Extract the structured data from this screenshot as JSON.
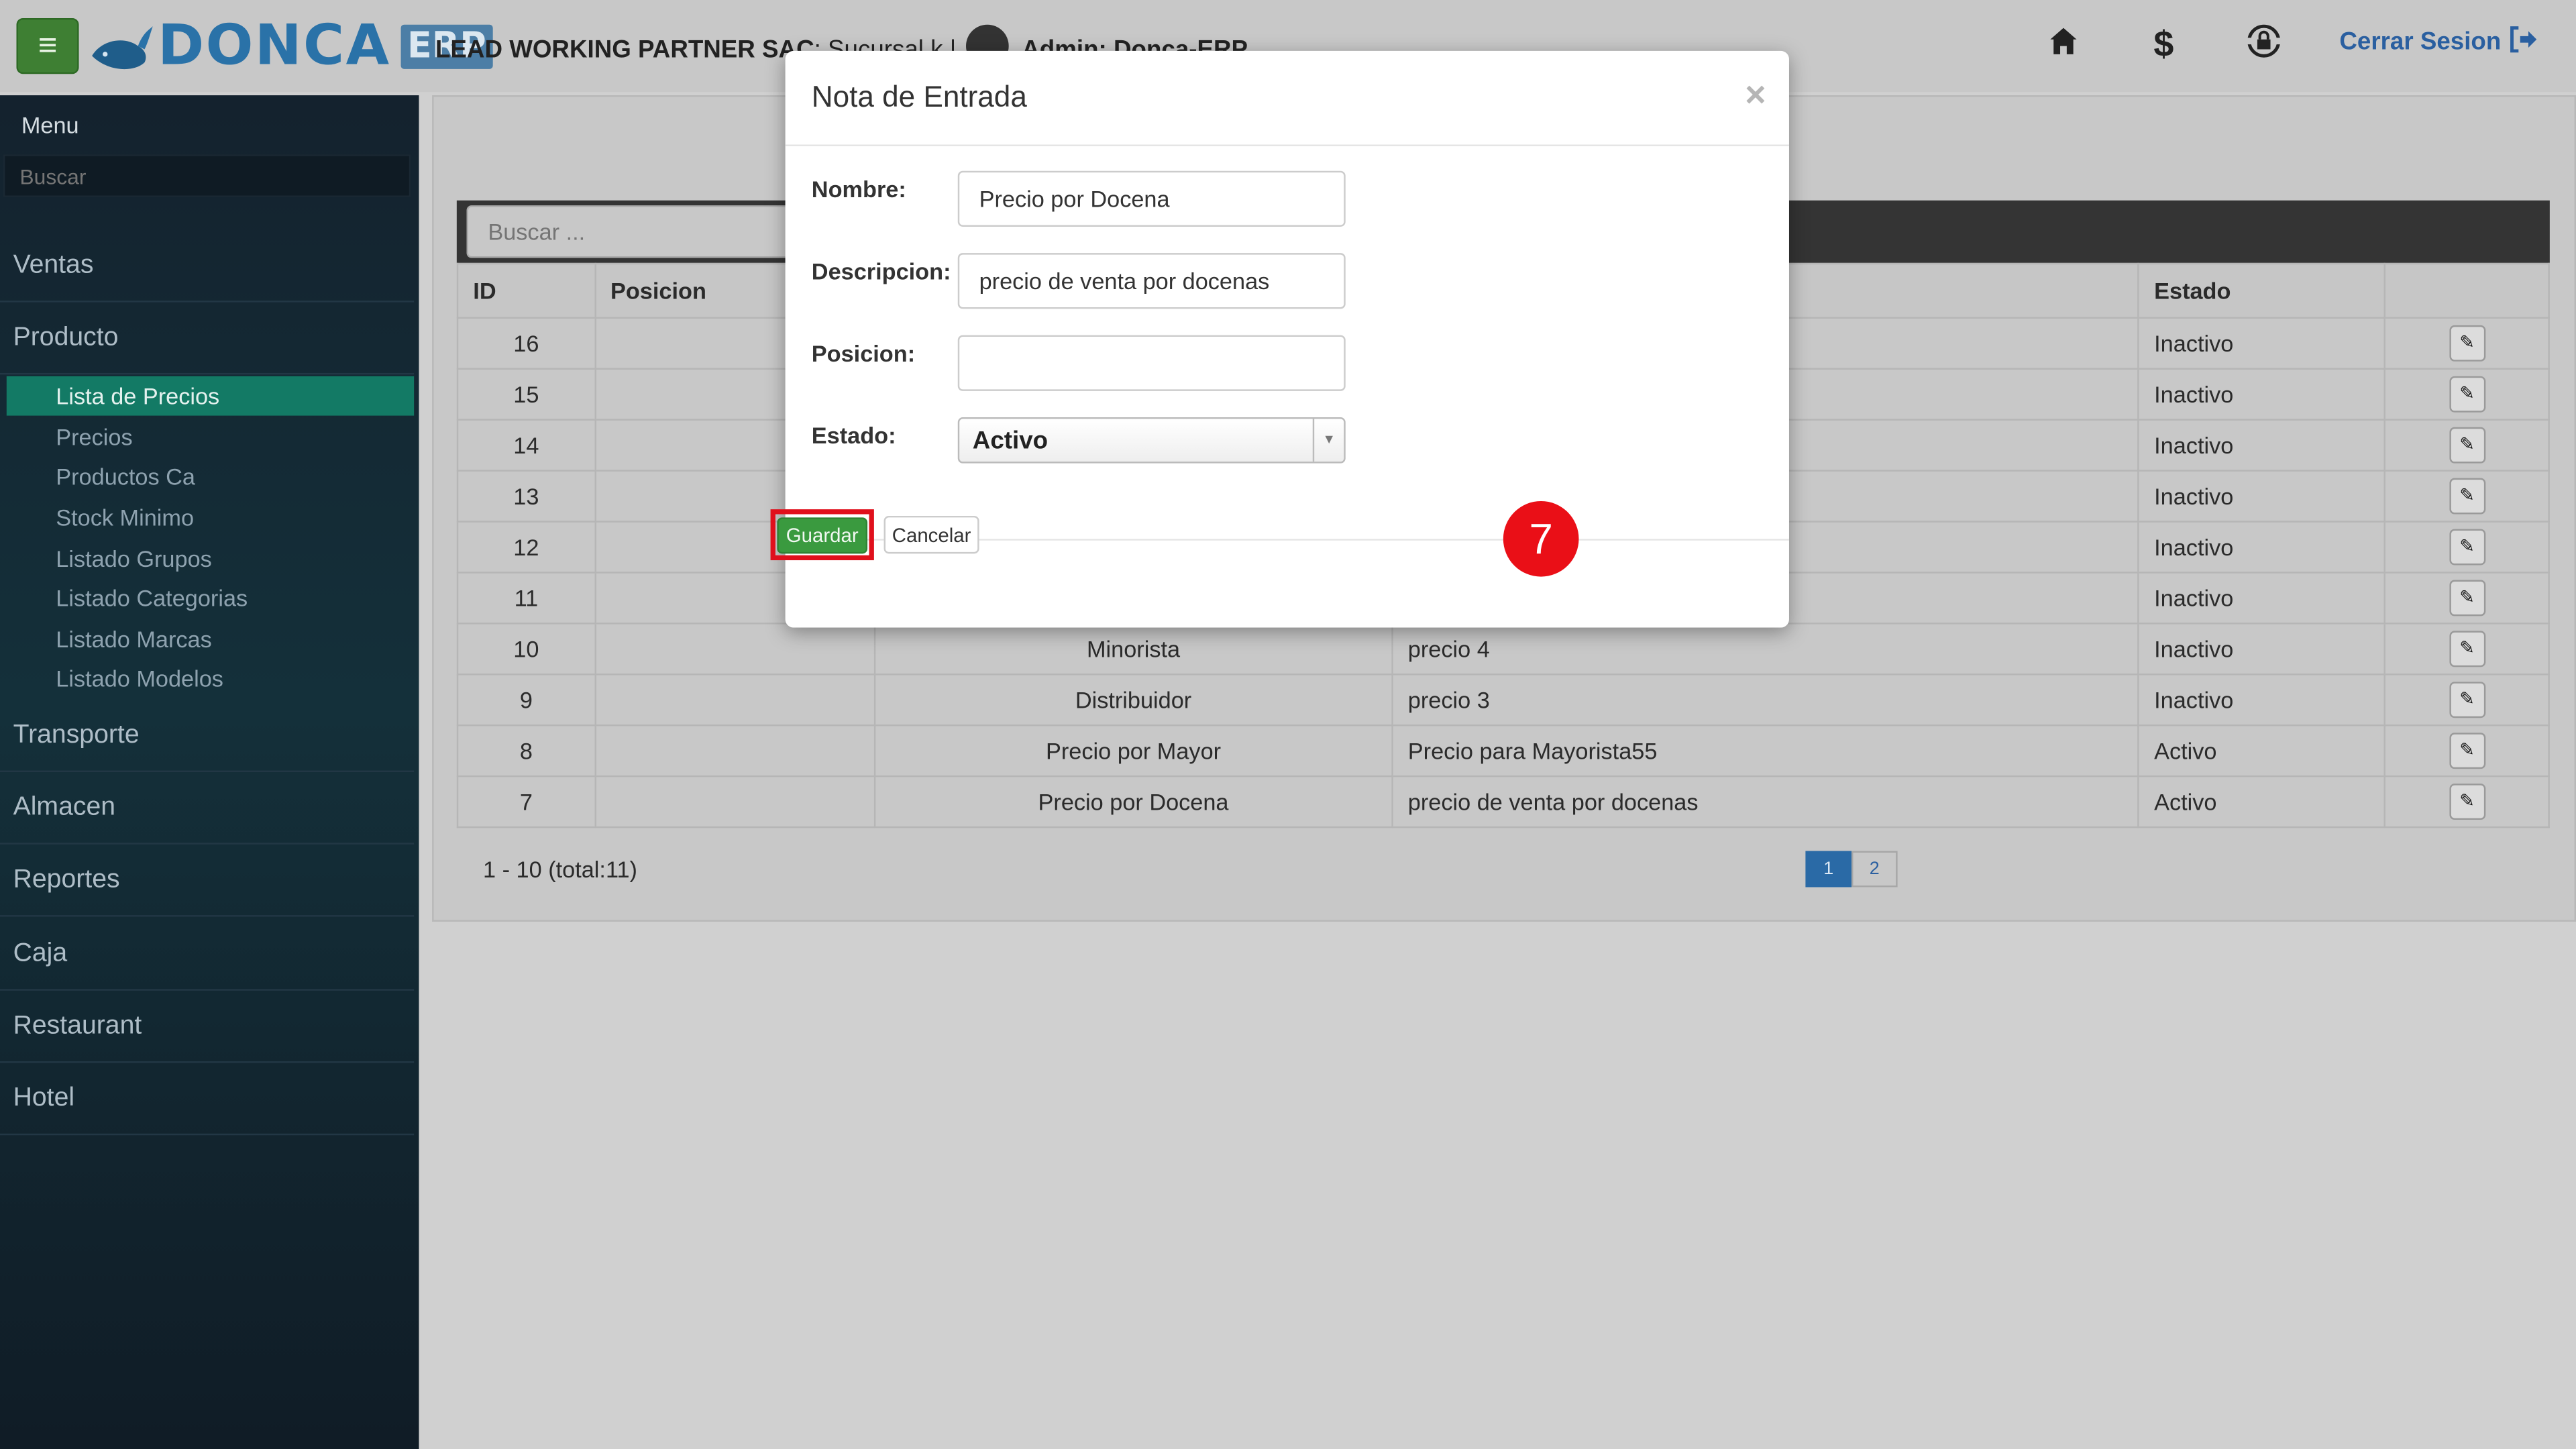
{
  "header": {
    "logo_text": "DONCA",
    "logo_badge": "ERP",
    "company_name": "LEAD WORKING PARTNER SAC",
    "branch": ": Sucursal k |",
    "admin": "Admin: Donca-ERP",
    "logout_label": "Cerrar Sesion",
    "icons": [
      "menu-icon",
      "home-icon",
      "dollar-icon",
      "lock-refresh-icon",
      "logout-icon"
    ]
  },
  "sidebar": {
    "title": "Menu",
    "search_placeholder": "Buscar",
    "sections": [
      "Ventas",
      "Producto",
      "Transporte",
      "Almacen",
      "Reportes",
      "Caja",
      "Restaurant",
      "Hotel"
    ],
    "producto_items": [
      "Lista de Precios",
      "Precios",
      "Productos Ca",
      "Stock Minimo",
      "Listado Grupos",
      "Listado Categorias",
      "Listado Marcas",
      "Listado Modelos"
    ],
    "active_item": "Lista de Precios"
  },
  "table": {
    "search_placeholder": "Buscar ...",
    "columns": [
      "ID",
      "Posicion",
      "",
      "",
      "Estado",
      ""
    ],
    "rows": [
      {
        "id": "16",
        "posicion": "",
        "nombre": "",
        "descripcion": "",
        "estado": "Inactivo"
      },
      {
        "id": "15",
        "posicion": "",
        "nombre": "",
        "descripcion": "",
        "estado": "Inactivo"
      },
      {
        "id": "14",
        "posicion": "",
        "nombre": "",
        "descripcion": "",
        "estado": "Inactivo"
      },
      {
        "id": "13",
        "posicion": "",
        "nombre": "",
        "descripcion": "",
        "estado": "Inactivo"
      },
      {
        "id": "12",
        "posicion": "",
        "nombre": "",
        "descripcion": "",
        "estado": "Inactivo"
      },
      {
        "id": "11",
        "posicion": "",
        "nombre": "",
        "descripcion": "",
        "estado": "Inactivo"
      },
      {
        "id": "10",
        "posicion": "",
        "nombre": "Minorista",
        "descripcion": "precio 4",
        "estado": "Inactivo"
      },
      {
        "id": "9",
        "posicion": "",
        "nombre": "Distribuidor",
        "descripcion": "precio 3",
        "estado": "Inactivo"
      },
      {
        "id": "8",
        "posicion": "",
        "nombre": "Precio por Mayor",
        "descripcion": "Precio para Mayorista55",
        "estado": "Activo"
      },
      {
        "id": "7",
        "posicion": "",
        "nombre": "Precio por Docena",
        "descripcion": "precio de venta por docenas",
        "estado": "Activo"
      }
    ],
    "pagination_info": "1 - 10 (total:11)",
    "pages": [
      "1",
      "2"
    ],
    "current_page": "1"
  },
  "modal": {
    "title": "Nota de Entrada",
    "close_symbol": "×",
    "fields": {
      "nombre_label": "Nombre:",
      "nombre_value": "Precio por Docena",
      "descripcion_label": "Descripcion:",
      "descripcion_value": "precio de venta por docenas",
      "posicion_label": "Posicion:",
      "posicion_value": "",
      "estado_label": "Estado:",
      "estado_value": "Activo"
    },
    "save_label": "Guardar",
    "cancel_label": "Cancelar"
  },
  "annotation": {
    "step_number": "7",
    "highlight_color": "#e0101c"
  },
  "colors": {
    "accent_green": "#3a9a3f",
    "active_menu": "#137a65",
    "link_blue": "#2a5fa0"
  }
}
